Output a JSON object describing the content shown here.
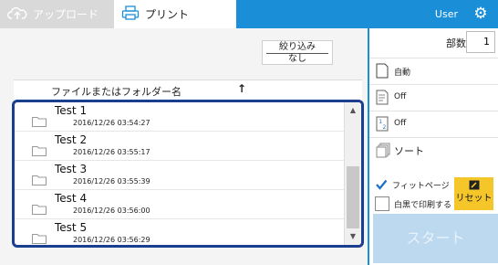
{
  "tabs": {
    "upload_label": "アップロード",
    "print_label": "プリント"
  },
  "header": {
    "user_label": "User"
  },
  "filter": {
    "label": "絞り込み",
    "value": "なし"
  },
  "file_list": {
    "column_name": "ファイルまたはフォルダー名",
    "sort_arrow": "↑",
    "items": [
      {
        "name": "Test 1",
        "date": "2016/12/26 03:54:27"
      },
      {
        "name": "Test 2",
        "date": "2016/12/26 03:55:17"
      },
      {
        "name": "Test 3",
        "date": "2016/12/26 03:55:39"
      },
      {
        "name": "Test 4",
        "date": "2016/12/26 03:56:00"
      },
      {
        "name": "Test 5",
        "date": "2016/12/26 03:56:29"
      }
    ]
  },
  "settings": {
    "copies_label": "部数",
    "copies_value": "1",
    "paper": "自動",
    "duplex": "Off",
    "nup": "Off",
    "sort": "ソート",
    "fit_page": "フィットページ",
    "mono": "白黒で印刷する",
    "fit_page_checked": true,
    "mono_checked": false
  },
  "reset_label": "リセット",
  "start_label": "スタート",
  "colors": {
    "accent": "#1a8fd8",
    "list_border": "#1b3f8f",
    "reset_bg": "#f5c62a",
    "start_bg": "#bcd9f0"
  }
}
